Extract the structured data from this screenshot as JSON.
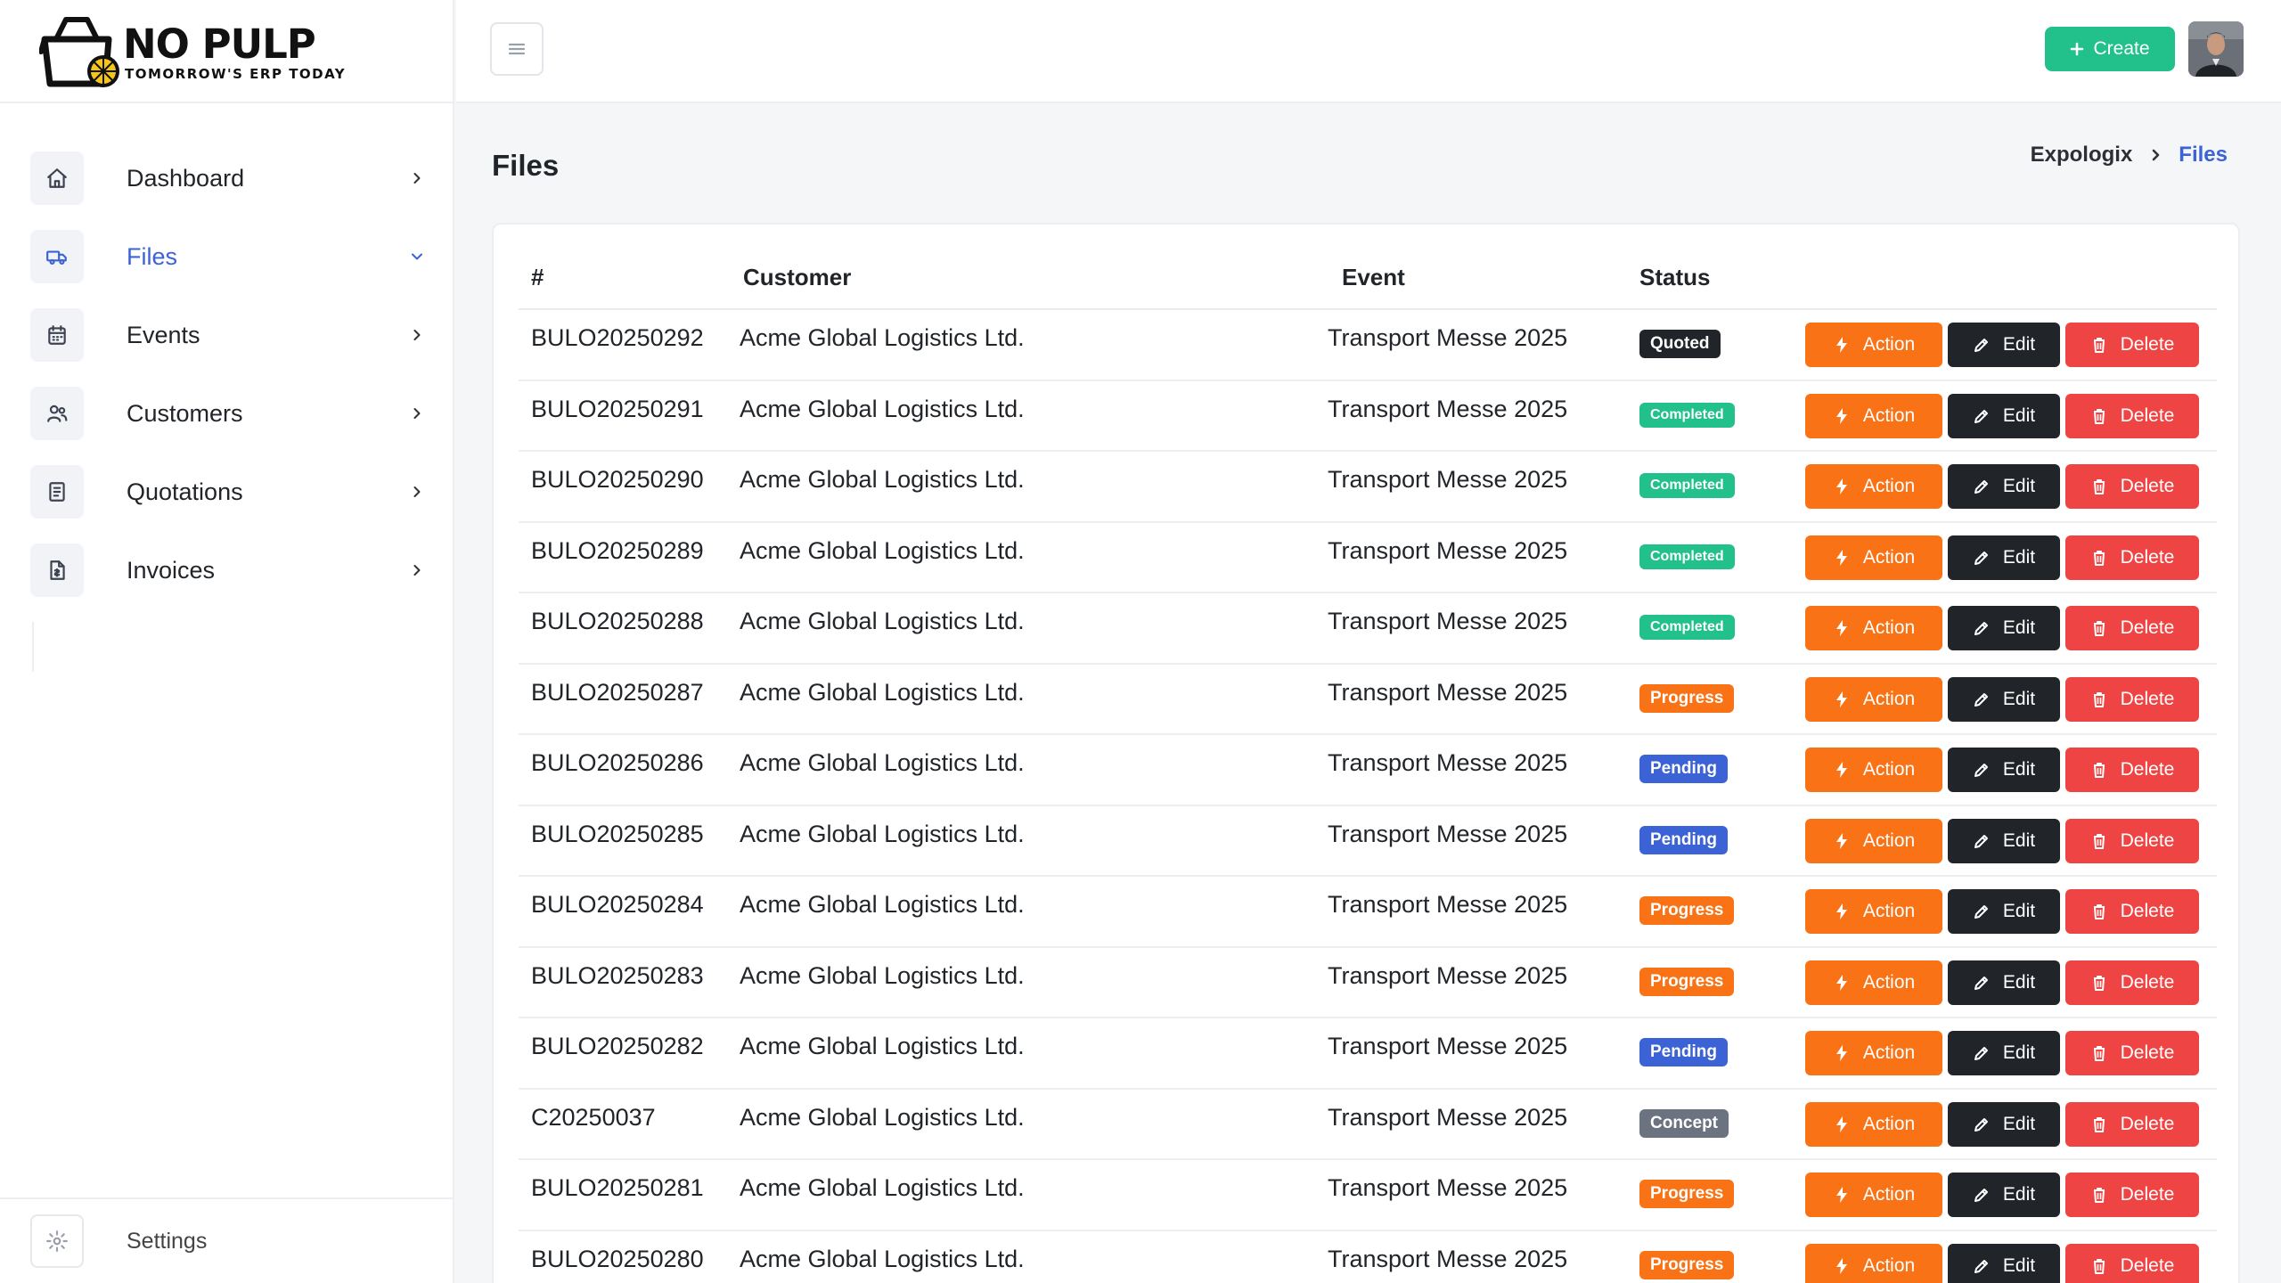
{
  "brand": {
    "name": "NO PULP",
    "tagline": "TOMORROW'S ERP TODAY"
  },
  "sidebar": {
    "items": [
      {
        "label": "Dashboard",
        "icon": "home-icon",
        "active": false
      },
      {
        "label": "Files",
        "icon": "truck-icon",
        "active": true
      },
      {
        "label": "Events",
        "icon": "calendar-icon",
        "active": false
      },
      {
        "label": "Customers",
        "icon": "users-icon",
        "active": false
      },
      {
        "label": "Quotations",
        "icon": "document-icon",
        "active": false
      },
      {
        "label": "Invoices",
        "icon": "invoice-icon",
        "active": false
      }
    ],
    "footer": {
      "label": "Settings",
      "icon": "gear-icon"
    }
  },
  "topbar": {
    "create_label": "Create"
  },
  "page": {
    "title": "Files"
  },
  "breadcrumb": {
    "root": "Expologix",
    "current": "Files"
  },
  "table": {
    "headers": {
      "num": "#",
      "customer": "Customer",
      "event": "Event",
      "status": "Status"
    },
    "action_label": "Action",
    "edit_label": "Edit",
    "delete_label": "Delete",
    "rows": [
      {
        "num": "BULO20250292",
        "customer": "Acme Global Logistics Ltd.",
        "event": "Transport Messe 2025",
        "status": "Quoted"
      },
      {
        "num": "BULO20250291",
        "customer": "Acme Global Logistics Ltd.",
        "event": "Transport Messe 2025",
        "status": "Completed"
      },
      {
        "num": "BULO20250290",
        "customer": "Acme Global Logistics Ltd.",
        "event": "Transport Messe 2025",
        "status": "Completed"
      },
      {
        "num": "BULO20250289",
        "customer": "Acme Global Logistics Ltd.",
        "event": "Transport Messe 2025",
        "status": "Completed"
      },
      {
        "num": "BULO20250288",
        "customer": "Acme Global Logistics Ltd.",
        "event": "Transport Messe 2025",
        "status": "Completed"
      },
      {
        "num": "BULO20250287",
        "customer": "Acme Global Logistics Ltd.",
        "event": "Transport Messe 2025",
        "status": "Progress"
      },
      {
        "num": "BULO20250286",
        "customer": "Acme Global Logistics Ltd.",
        "event": "Transport Messe 2025",
        "status": "Pending"
      },
      {
        "num": "BULO20250285",
        "customer": "Acme Global Logistics Ltd.",
        "event": "Transport Messe 2025",
        "status": "Pending"
      },
      {
        "num": "BULO20250284",
        "customer": "Acme Global Logistics Ltd.",
        "event": "Transport Messe 2025",
        "status": "Progress"
      },
      {
        "num": "BULO20250283",
        "customer": "Acme Global Logistics Ltd.",
        "event": "Transport Messe 2025",
        "status": "Progress"
      },
      {
        "num": "BULO20250282",
        "customer": "Acme Global Logistics Ltd.",
        "event": "Transport Messe 2025",
        "status": "Pending"
      },
      {
        "num": "C20250037",
        "customer": "Acme Global Logistics Ltd.",
        "event": "Transport Messe 2025",
        "status": "Concept"
      },
      {
        "num": "BULO20250281",
        "customer": "Acme Global Logistics Ltd.",
        "event": "Transport Messe 2025",
        "status": "Progress"
      },
      {
        "num": "BULO20250280",
        "customer": "Acme Global Logistics Ltd.",
        "event": "Transport Messe 2025",
        "status": "Progress"
      }
    ]
  },
  "colors": {
    "accent": "#3b63d6",
    "create": "#22c08a",
    "action": "#f97316",
    "edit": "#212529",
    "delete": "#ef4444",
    "status": {
      "Quoted": "#212529",
      "Completed": "#22c08a",
      "Progress": "#f97316",
      "Pending": "#3b63d6",
      "Concept": "#6b7280"
    }
  }
}
